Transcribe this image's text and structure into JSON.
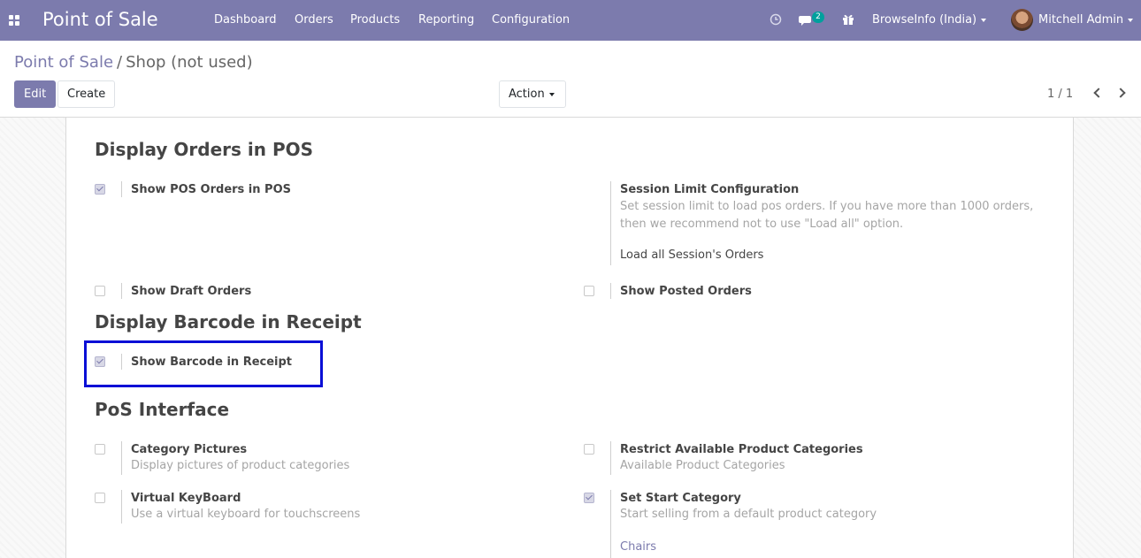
{
  "navbar": {
    "app_title": "Point of Sale",
    "menu": [
      "Dashboard",
      "Orders",
      "Products",
      "Reporting",
      "Configuration"
    ],
    "messages_badge": "2",
    "company": "BrowseInfo (India)",
    "user": "Mitchell Admin"
  },
  "breadcrumb": {
    "parent": "Point of Sale",
    "separator": "/",
    "current": "Shop (not used)"
  },
  "buttons": {
    "edit": "Edit",
    "create": "Create",
    "action": "Action"
  },
  "pager": {
    "text": "1 / 1"
  },
  "sections": {
    "display_orders": {
      "title": "Display Orders in POS",
      "show_pos_orders": {
        "label": "Show POS Orders in POS",
        "checked": true
      },
      "session_limit": {
        "label": "Session Limit Configuration",
        "desc1": "Set session limit to load pos orders. If you have more than 1000 orders,",
        "desc2": "then we recommend not to use \"Load all\" option.",
        "value": "Load all Session's Orders"
      },
      "show_draft": {
        "label": "Show Draft Orders",
        "checked": false
      },
      "show_posted": {
        "label": "Show Posted Orders",
        "checked": false
      }
    },
    "display_barcode": {
      "title": "Display Barcode in Receipt",
      "show_barcode": {
        "label": "Show Barcode in Receipt",
        "checked": true
      }
    },
    "pos_interface": {
      "title": "PoS Interface",
      "category_pictures": {
        "label": "Category Pictures",
        "desc": "Display pictures of product categories",
        "checked": false
      },
      "restrict_categories": {
        "label": "Restrict Available Product Categories",
        "desc": "Available Product Categories",
        "checked": false
      },
      "virtual_keyboard": {
        "label": "Virtual KeyBoard",
        "desc": "Use a virtual keyboard for touchscreens",
        "checked": false
      },
      "start_category": {
        "label": "Set Start Category",
        "desc": "Start selling from a default product category",
        "value": "Chairs",
        "checked": true
      }
    }
  },
  "colors": {
    "brand": "#7c7bad",
    "badge": "#00a09d",
    "highlight": "#0a0fd6"
  }
}
